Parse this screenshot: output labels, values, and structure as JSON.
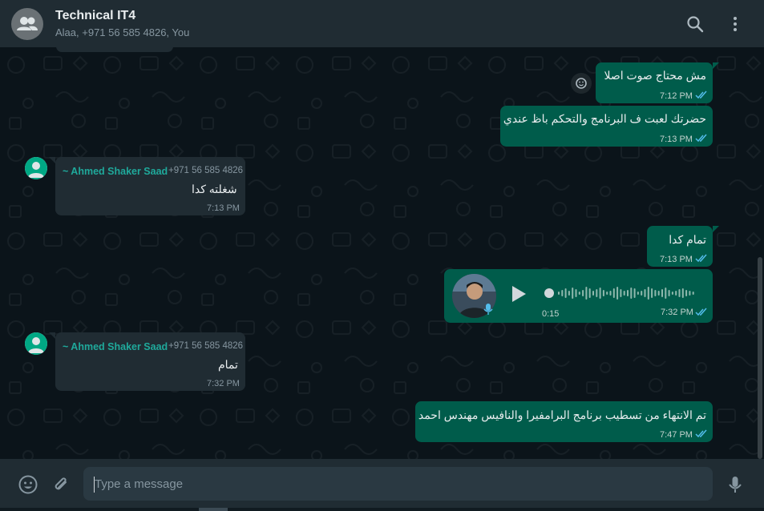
{
  "header": {
    "title": "Technical IT4",
    "subtitle": "Alaa, +971 56 585 4826, You"
  },
  "messages": [
    {
      "text": "مش محتاج صوت اصلا",
      "time": "7:12 PM"
    },
    {
      "text": "حضرتك لعبت ف البرنامج والتحكم باظ عندي",
      "time": "7:13 PM"
    },
    {
      "sender": "~ Ahmed Shaker Saad",
      "phone": "+971 56 585 4826",
      "text": "شغلته كدا",
      "time": "7:13 PM"
    },
    {
      "text": "تمام كدا",
      "time": "7:13 PM"
    },
    {
      "voice_duration": "0:15",
      "time": "7:32 PM"
    },
    {
      "sender": "~ Ahmed Shaker Saad",
      "phone": "+971 56 585 4826",
      "text": "تمام",
      "time": "7:32 PM"
    },
    {
      "text": "تم الانتهاء من تسطيب برنامج البرامفيرا والنافيس مهندس احمد",
      "time": "7:47 PM"
    }
  ],
  "composer": {
    "placeholder": "Type a message"
  },
  "colors": {
    "outgoing_bubble": "#005c4b",
    "incoming_bubble": "#202c33",
    "sender_name": "#1fa99b",
    "read_ticks": "#53bdeb",
    "background": "#0b141a"
  },
  "icons": {
    "header": [
      "group-avatar-icon",
      "search-icon",
      "menu-icon"
    ],
    "composer": [
      "emoji-icon",
      "attach-icon",
      "mic-icon"
    ],
    "message": [
      "double-check-icon",
      "play-icon",
      "mic-badge-icon",
      "user-avatar-icon",
      "reaction-emoji-icon"
    ]
  }
}
